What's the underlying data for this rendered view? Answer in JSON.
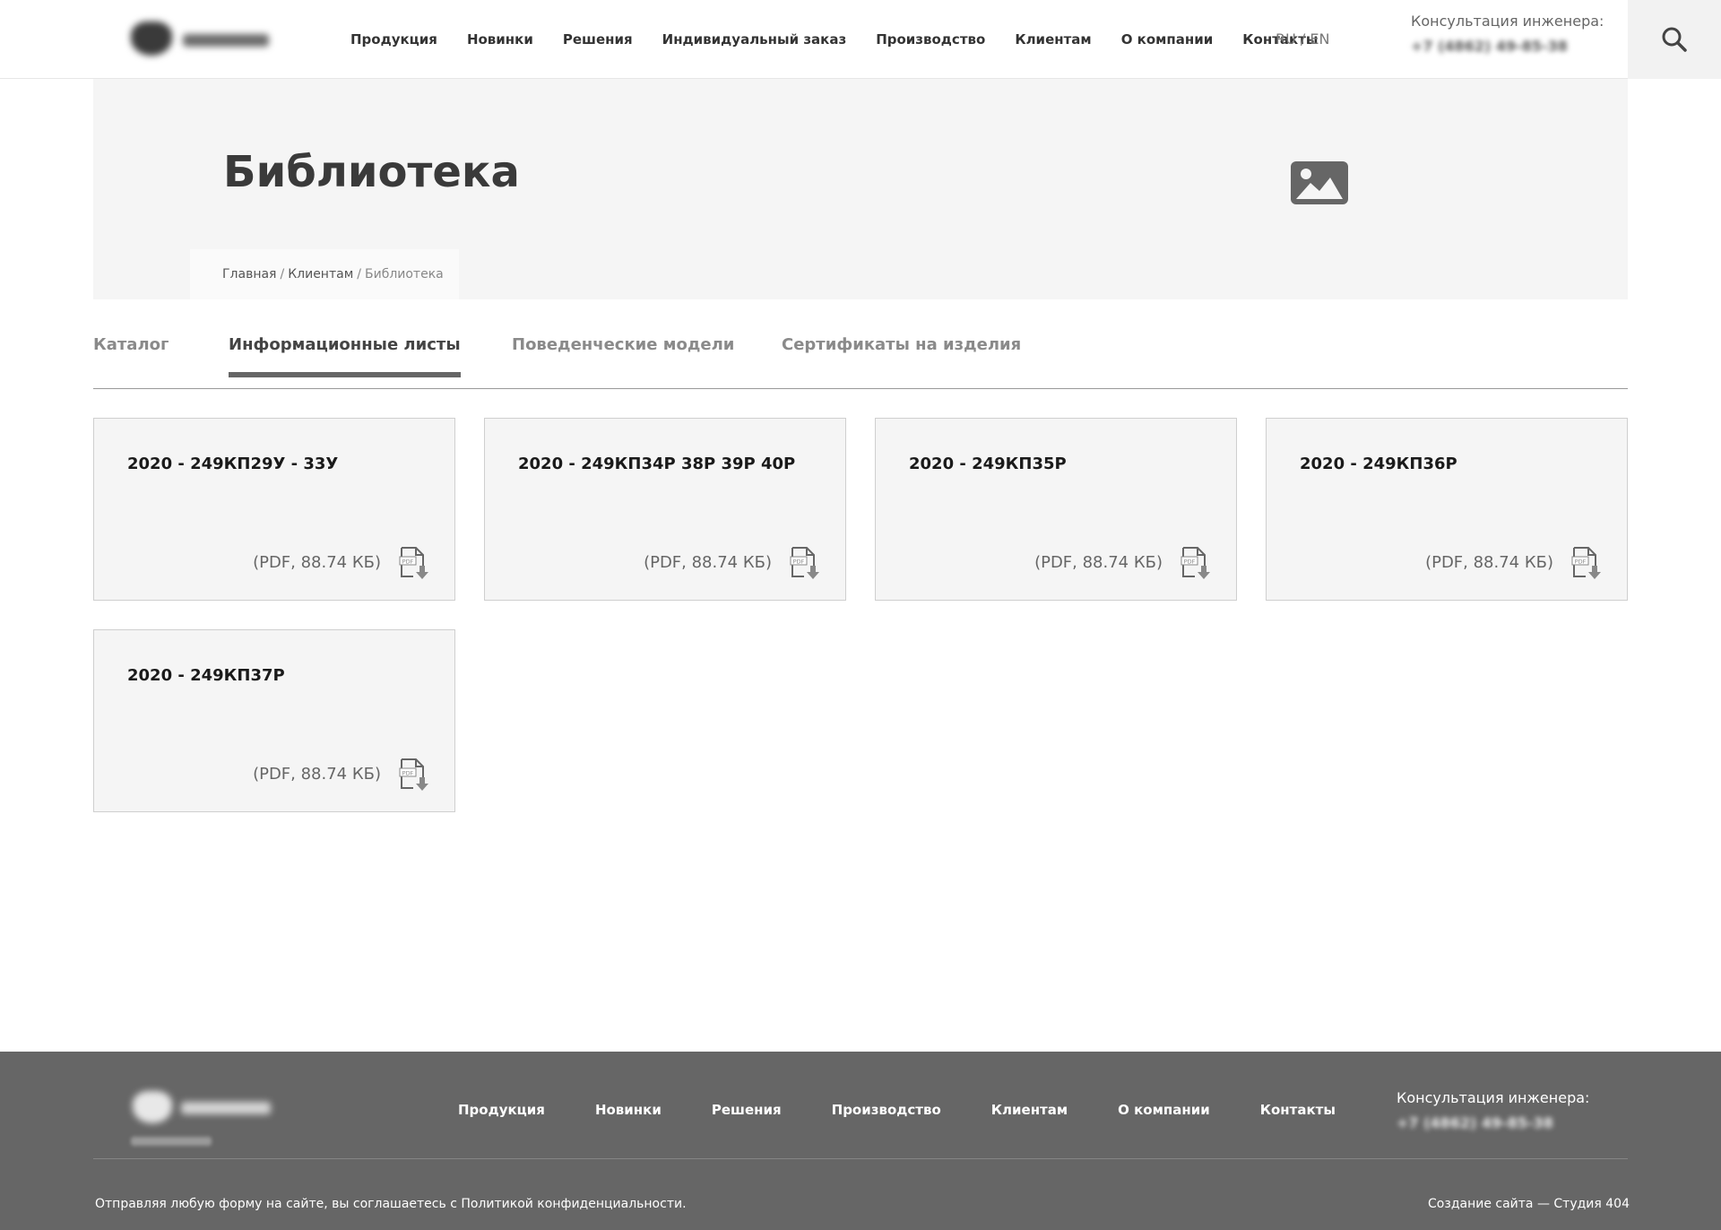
{
  "header": {
    "nav": [
      "Продукция",
      "Новинки",
      "Решения",
      "Индивидуальный заказ",
      "Производство",
      "Клиентам",
      "О компании",
      "Контакты"
    ],
    "lang": "RU / EN",
    "consult_label": "Консультация инженера:",
    "phone": "+7 (4862) 49-85-38",
    "search_icon": "search-icon"
  },
  "hero": {
    "title": "Библиотека",
    "image_icon": "image-placeholder-icon",
    "breadcrumb": {
      "home": "Главная",
      "sep1": "/",
      "section": "Клиентам",
      "sep2": "/",
      "current": "Библиотека"
    }
  },
  "tabs": [
    {
      "label": "Каталог",
      "active": false
    },
    {
      "label": "Информационные листы",
      "active": true
    },
    {
      "label": "Поведенческие модели",
      "active": false
    },
    {
      "label": "Сертификаты на изделия",
      "active": false
    }
  ],
  "documents": [
    {
      "title": "2020 - 249КП29У - 33У",
      "meta": "(PDF, 88.74 КБ)"
    },
    {
      "title": "2020 - 249КП34Р 38Р 39Р 40Р",
      "meta": "(PDF, 88.74 КБ)"
    },
    {
      "title": "2020 - 249КП35Р",
      "meta": "(PDF, 88.74 КБ)"
    },
    {
      "title": "2020 - 249КП36Р",
      "meta": "(PDF, 88.74 КБ)"
    },
    {
      "title": "2020 - 249КП37Р",
      "meta": "(PDF, 88.74 КБ)"
    }
  ],
  "footer": {
    "nav": [
      "Продукция",
      "Новинки",
      "Решения",
      "Производство",
      "Клиентам",
      "О компании",
      "Контакты"
    ],
    "consult_label": "Консультация инженера:",
    "phone": "+7 (4862) 49-85-38",
    "policy": "Отправляя любую форму на сайте, вы соглашаетесь с Политикой конфиденциальности.",
    "credit": "Создание сайта — Студия 404"
  },
  "colors": {
    "footer_bg": "#666666",
    "hero_bg": "#f5f5f5",
    "card_bg": "#f5f5f5",
    "tab_active": "#444444",
    "tab_inactive": "#8a8a8a"
  }
}
